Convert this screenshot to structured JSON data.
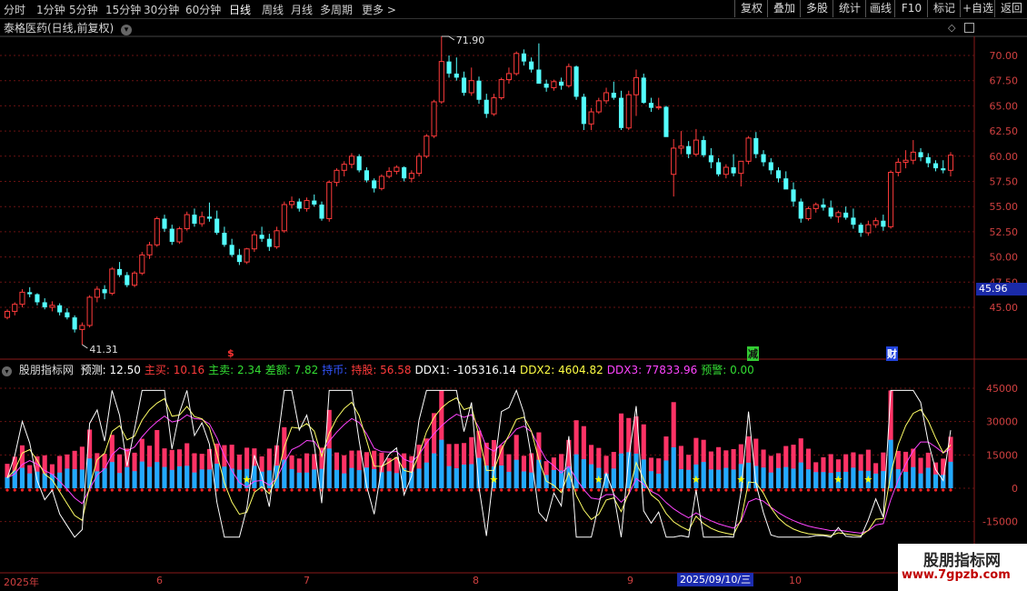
{
  "toolbar": {
    "periods": [
      "分时",
      "1分钟",
      "5分钟",
      "15分钟",
      "30分钟",
      "60分钟",
      "日线",
      "周线",
      "月线",
      "多周期",
      "更多"
    ],
    "active_period": "日线",
    "right_buttons": [
      "复权",
      "叠加",
      "多股",
      "统计",
      "画线",
      "F10",
      "标记",
      "+自选",
      "返回"
    ]
  },
  "chart_header": {
    "title": "泰格医药(日线,前复权)"
  },
  "indicator_header": {
    "name": "股朋指标网",
    "items": [
      {
        "label": "预测: 12.50",
        "color": "#ffffff"
      },
      {
        "label": "主买: 10.16",
        "color": "#ff3b3b"
      },
      {
        "label": "主卖: 2.34",
        "color": "#33dd33"
      },
      {
        "label": "差额: 7.82",
        "color": "#33dd33"
      },
      {
        "label": "持币:",
        "color": "#3355ff"
      },
      {
        "label": "持股: 56.58",
        "color": "#ff3b3b"
      },
      {
        "label": "DDX1: -105316.14",
        "color": "#ffffff"
      },
      {
        "label": "DDX2: 4604.82",
        "color": "#ffff44"
      },
      {
        "label": "DDX3: 77833.96",
        "color": "#ff44ff"
      },
      {
        "label": "预警: 0.00",
        "color": "#33dd33"
      }
    ]
  },
  "price_axis": [
    "70.00",
    "67.50",
    "65.00",
    "62.50",
    "60.00",
    "57.50",
    "55.00",
    "52.50",
    "50.00",
    "47.50",
    "45.00"
  ],
  "indicator_axis": [
    "45000",
    "30000",
    "15000",
    "0",
    "-15000"
  ],
  "annotations": {
    "high": "71.90",
    "low": "41.31",
    "current_price": "45.96",
    "signals": [
      "$",
      "减",
      "财"
    ]
  },
  "date_axis": {
    "labels": [
      "2025年",
      "6",
      "7",
      "8",
      "9",
      "10"
    ],
    "cursor": "2025/09/10/三"
  },
  "watermark": {
    "line1": "股朋指标网",
    "line2": "www.7gpzb.com"
  },
  "chart_data": {
    "type": "candlestick",
    "price_range": [
      40,
      73
    ],
    "indicator_range": [
      -25000,
      50000
    ],
    "candles": [
      [
        44.0,
        44.8,
        43.8,
        44.6
      ],
      [
        44.6,
        45.5,
        44.2,
        45.3
      ],
      [
        45.3,
        46.8,
        45.0,
        46.5
      ],
      [
        46.5,
        47.0,
        46.0,
        46.3
      ],
      [
        46.3,
        46.4,
        45.2,
        45.5
      ],
      [
        45.5,
        45.9,
        44.8,
        45.0
      ],
      [
        45.0,
        45.6,
        44.6,
        45.2
      ],
      [
        45.2,
        45.4,
        44.2,
        44.5
      ],
      [
        44.5,
        44.9,
        43.8,
        44.0
      ],
      [
        44.0,
        44.2,
        42.5,
        42.8
      ],
      [
        42.8,
        43.5,
        41.3,
        43.2
      ],
      [
        43.2,
        46.2,
        43.0,
        46.0
      ],
      [
        46.0,
        47.1,
        45.5,
        46.8
      ],
      [
        46.8,
        47.2,
        45.8,
        46.4
      ],
      [
        46.4,
        49.0,
        46.2,
        48.8
      ],
      [
        48.8,
        49.5,
        48.0,
        48.2
      ],
      [
        48.2,
        48.5,
        47.0,
        47.2
      ],
      [
        47.2,
        48.6,
        47.0,
        48.4
      ],
      [
        48.4,
        50.5,
        48.2,
        50.2
      ],
      [
        50.2,
        51.5,
        49.8,
        51.2
      ],
      [
        51.2,
        54.0,
        51.0,
        53.8
      ],
      [
        53.8,
        54.2,
        52.5,
        52.8
      ],
      [
        52.8,
        53.2,
        51.2,
        51.5
      ],
      [
        51.5,
        53.0,
        51.3,
        52.8
      ],
      [
        52.8,
        54.5,
        52.6,
        54.2
      ],
      [
        54.2,
        54.8,
        53.0,
        53.3
      ],
      [
        53.3,
        54.5,
        53.0,
        54.0
      ],
      [
        54.0,
        55.4,
        53.5,
        53.8
      ],
      [
        53.8,
        54.6,
        52.2,
        52.4
      ],
      [
        52.4,
        53.0,
        51.0,
        51.2
      ],
      [
        51.2,
        51.8,
        50.0,
        50.2
      ],
      [
        50.2,
        50.8,
        49.2,
        49.5
      ],
      [
        49.5,
        50.9,
        49.3,
        50.8
      ],
      [
        50.8,
        52.6,
        50.5,
        52.2
      ],
      [
        52.2,
        53.0,
        51.5,
        51.8
      ],
      [
        51.8,
        52.3,
        50.6,
        51.0
      ],
      [
        51.0,
        53.0,
        50.8,
        52.6
      ],
      [
        52.6,
        55.5,
        52.4,
        55.2
      ],
      [
        55.2,
        56.0,
        54.8,
        55.5
      ],
      [
        55.5,
        55.8,
        54.5,
        54.8
      ],
      [
        54.8,
        55.9,
        54.5,
        55.6
      ],
      [
        55.6,
        56.2,
        55.0,
        55.2
      ],
      [
        55.2,
        55.5,
        53.6,
        53.8
      ],
      [
        53.8,
        57.6,
        53.5,
        57.4
      ],
      [
        57.4,
        58.8,
        57.0,
        58.6
      ],
      [
        58.6,
        59.5,
        58.0,
        59.2
      ],
      [
        59.2,
        60.3,
        58.8,
        60.0
      ],
      [
        60.0,
        60.2,
        58.4,
        58.6
      ],
      [
        58.6,
        58.9,
        57.4,
        57.6
      ],
      [
        57.6,
        57.8,
        56.4,
        56.8
      ],
      [
        56.8,
        58.2,
        56.6,
        58.0
      ],
      [
        58.0,
        58.9,
        57.8,
        58.5
      ],
      [
        58.5,
        59.1,
        58.2,
        58.9
      ],
      [
        58.9,
        59.0,
        57.5,
        57.8
      ],
      [
        57.8,
        58.6,
        57.4,
        58.3
      ],
      [
        58.3,
        60.3,
        58.0,
        60.0
      ],
      [
        60.0,
        62.2,
        59.8,
        62.0
      ],
      [
        62.0,
        65.6,
        61.8,
        65.4
      ],
      [
        65.4,
        71.9,
        65.2,
        69.4
      ],
      [
        69.4,
        70.0,
        67.8,
        68.2
      ],
      [
        68.2,
        69.8,
        67.5,
        67.8
      ],
      [
        67.8,
        68.4,
        66.0,
        66.3
      ],
      [
        66.3,
        68.8,
        66.0,
        67.5
      ],
      [
        67.5,
        67.9,
        65.2,
        65.6
      ],
      [
        65.6,
        66.2,
        63.8,
        64.2
      ],
      [
        64.2,
        66.2,
        64.0,
        65.8
      ],
      [
        65.8,
        67.8,
        65.6,
        67.6
      ],
      [
        67.6,
        68.8,
        67.2,
        68.2
      ],
      [
        68.2,
        70.4,
        68.0,
        70.2
      ],
      [
        70.2,
        70.6,
        69.0,
        69.4
      ],
      [
        69.4,
        69.8,
        68.3,
        68.6
      ],
      [
        68.6,
        71.2,
        68.3,
        67.2
      ],
      [
        67.2,
        67.6,
        66.4,
        66.8
      ],
      [
        66.8,
        67.6,
        66.5,
        67.4
      ],
      [
        67.4,
        67.8,
        66.6,
        67.0
      ],
      [
        67.0,
        69.2,
        66.8,
        68.9
      ],
      [
        68.9,
        69.0,
        65.6,
        65.9
      ],
      [
        65.9,
        66.2,
        62.6,
        63.2
      ],
      [
        63.2,
        64.8,
        62.6,
        64.4
      ],
      [
        64.4,
        65.8,
        64.2,
        65.5
      ],
      [
        65.5,
        66.8,
        65.2,
        66.3
      ],
      [
        66.3,
        67.4,
        65.6,
        65.8
      ],
      [
        65.8,
        66.5,
        62.6,
        62.8
      ],
      [
        62.8,
        66.5,
        62.6,
        66.1
      ],
      [
        66.1,
        68.6,
        64.0,
        67.8
      ],
      [
        67.8,
        68.2,
        65.2,
        65.3
      ],
      [
        65.3,
        65.8,
        64.4,
        64.8
      ],
      [
        64.8,
        65.8,
        64.6,
        64.9
      ],
      [
        64.9,
        65.0,
        62.6,
        61.9
      ],
      [
        58.2,
        61.7,
        56.0,
        60.8
      ],
      [
        60.8,
        62.5,
        60.2,
        61.0
      ],
      [
        61.0,
        61.5,
        59.8,
        60.2
      ],
      [
        60.2,
        62.7,
        60.0,
        61.6
      ],
      [
        61.6,
        62.0,
        59.9,
        60.1
      ],
      [
        60.1,
        60.8,
        58.8,
        59.4
      ],
      [
        59.4,
        59.8,
        58.0,
        58.2
      ],
      [
        58.2,
        59.2,
        57.8,
        58.9
      ],
      [
        58.9,
        60.2,
        58.0,
        58.3
      ],
      [
        58.3,
        59.0,
        57.0,
        59.5
      ],
      [
        59.5,
        62.0,
        59.2,
        61.8
      ],
      [
        61.8,
        62.4,
        59.8,
        60.2
      ],
      [
        60.2,
        60.6,
        59.0,
        59.4
      ],
      [
        59.4,
        59.8,
        58.2,
        58.6
      ],
      [
        58.6,
        58.9,
        57.4,
        57.8
      ],
      [
        57.8,
        58.5,
        56.8,
        56.7
      ],
      [
        56.7,
        57.4,
        55.0,
        55.5
      ],
      [
        55.5,
        55.8,
        53.4,
        53.8
      ],
      [
        53.8,
        55.0,
        53.6,
        54.8
      ],
      [
        54.8,
        55.4,
        54.4,
        55.2
      ],
      [
        55.2,
        55.8,
        54.6,
        54.9
      ],
      [
        54.9,
        55.6,
        53.8,
        54.0
      ],
      [
        54.0,
        54.6,
        53.4,
        54.4
      ],
      [
        54.4,
        55.0,
        53.7,
        53.9
      ],
      [
        53.9,
        54.8,
        52.8,
        53.2
      ],
      [
        53.2,
        53.4,
        52.0,
        52.4
      ],
      [
        52.4,
        53.6,
        52.1,
        53.2
      ],
      [
        53.2,
        53.9,
        52.9,
        53.6
      ],
      [
        53.6,
        54.2,
        52.6,
        53.0
      ],
      [
        53.0,
        58.6,
        52.8,
        58.4
      ],
      [
        58.4,
        59.8,
        58.0,
        59.4
      ],
      [
        59.4,
        60.6,
        58.8,
        59.6
      ],
      [
        59.6,
        61.6,
        59.2,
        60.4
      ],
      [
        60.4,
        60.8,
        59.5,
        59.9
      ],
      [
        59.9,
        60.3,
        58.9,
        59.3
      ],
      [
        59.3,
        59.6,
        58.5,
        58.8
      ],
      [
        58.8,
        59.6,
        58.3,
        58.6
      ],
      [
        58.6,
        60.4,
        58.0,
        60.1
      ]
    ]
  }
}
